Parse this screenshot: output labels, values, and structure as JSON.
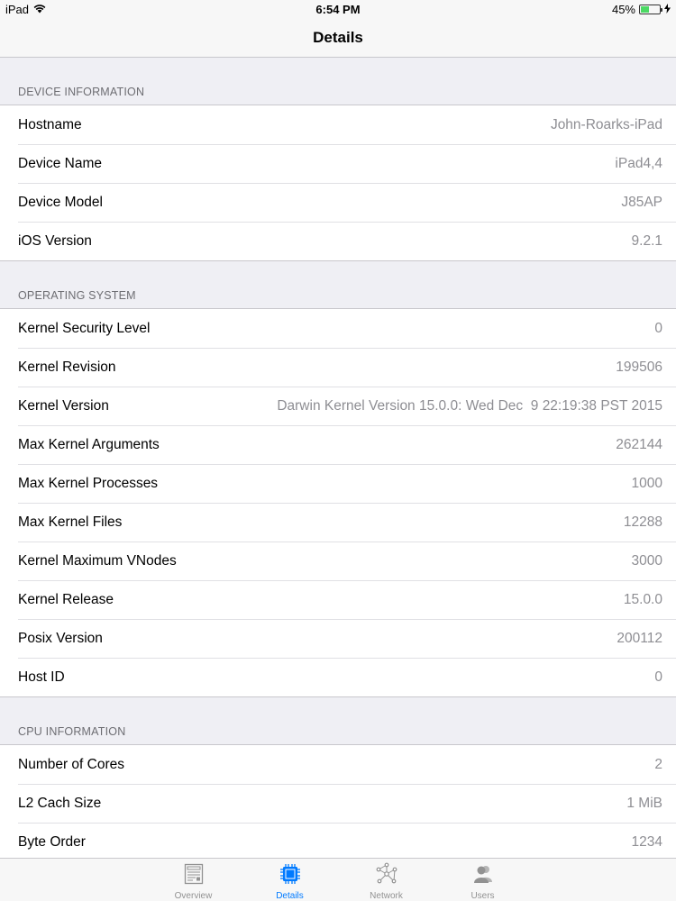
{
  "status_bar": {
    "device": "iPad",
    "time": "6:54 PM",
    "battery": "45%",
    "battery_level": 0.45
  },
  "nav": {
    "title": "Details"
  },
  "sections": [
    {
      "header": "DEVICE INFORMATION",
      "rows": [
        {
          "label": "Hostname",
          "value": "John-Roarks-iPad"
        },
        {
          "label": "Device Name",
          "value": "iPad4,4"
        },
        {
          "label": "Device Model",
          "value": "J85AP"
        },
        {
          "label": "iOS Version",
          "value": "9.2.1"
        }
      ]
    },
    {
      "header": "OPERATING SYSTEM",
      "rows": [
        {
          "label": "Kernel Security Level",
          "value": "0"
        },
        {
          "label": "Kernel Revision",
          "value": "199506"
        },
        {
          "label": "Kernel Version",
          "value": "Darwin Kernel Version 15.0.0: Wed Dec  9 22:19:38 PST 2015"
        },
        {
          "label": "Max Kernel Arguments",
          "value": "262144"
        },
        {
          "label": "Max Kernel Processes",
          "value": "1000"
        },
        {
          "label": "Max Kernel Files",
          "value": "12288"
        },
        {
          "label": "Kernel Maximum VNodes",
          "value": "3000"
        },
        {
          "label": "Kernel Release",
          "value": "15.0.0"
        },
        {
          "label": "Posix Version",
          "value": "200112"
        },
        {
          "label": "Host ID",
          "value": "0"
        }
      ]
    },
    {
      "header": "CPU INFORMATION",
      "rows": [
        {
          "label": "Number of Cores",
          "value": "2"
        },
        {
          "label": "L2 Cach Size",
          "value": "1 MiB"
        },
        {
          "label": "Byte Order",
          "value": "1234"
        }
      ]
    }
  ],
  "tabs": [
    {
      "label": "Overview",
      "icon": "overview-icon",
      "active": false
    },
    {
      "label": "Details",
      "icon": "chip-icon",
      "active": true
    },
    {
      "label": "Network",
      "icon": "network-icon",
      "active": false
    },
    {
      "label": "Users",
      "icon": "users-icon",
      "active": false
    }
  ],
  "colors": {
    "accent": "#007aff",
    "inactive_tab": "#929292",
    "secondary_text": "#8e8e93",
    "battery_fill": "#4cd964"
  }
}
